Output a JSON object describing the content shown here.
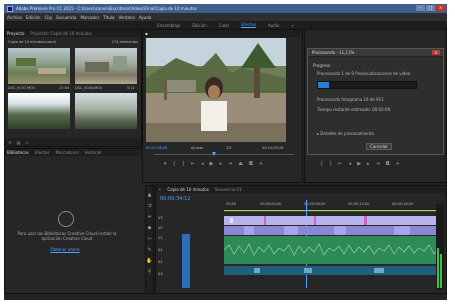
{
  "titlebar": {
    "title": "Adobe Premiere Pro CC 2015 - C:\\Users\\canvia\\Escritorio\\Videos\\Final\\Copia de 10 minutos",
    "min": "–",
    "max": "□",
    "close": "×"
  },
  "menu": [
    "Archivo",
    "Edición",
    "Clip",
    "Secuencia",
    "Marcador",
    "Título",
    "Ventana",
    "Ayuda"
  ],
  "workspaces": [
    "Ensamblaje",
    "Edición",
    "Color",
    "Efectos",
    "Audio",
    "»"
  ],
  "project": {
    "tab": "Proyecto",
    "tab2": "Proyecto: Copia de 10 minutos",
    "path": "Copia de 10 minutos.prproj",
    "count": "174 elementos",
    "clips": [
      {
        "name": "DSC_0037.MOV",
        "dur": "17:00"
      },
      {
        "name": "DSC_0040.MOV",
        "dur": "5:11"
      }
    ]
  },
  "library": {
    "tabs": [
      "Bibliotecas",
      "Efectos",
      "Marcadores",
      "Historial"
    ],
    "message": "Para usar las Bibliotecas Creative Cloud instale la aplicación Creative Cloud",
    "link": "Obtener ahora"
  },
  "program": {
    "timecode": "00;01;38;08",
    "fit": "Ajustar",
    "ratio": "1/2",
    "end": "00;10;09;26"
  },
  "source": {
    "timecode": "00;00;00;00",
    "end": "00;00;00;00"
  },
  "timeline": {
    "tabs": [
      "Copia de 10 minutos",
      "Secuencia 01"
    ],
    "timecode": "00;00;34;12",
    "ruler": [
      "00;00",
      "00;00;04;00",
      "00;00;08;00",
      "00;00;12;00",
      "00;00;16;00",
      "00;00;20;00"
    ],
    "tracks": [
      "V3",
      "V2",
      "V1",
      "A1",
      "A2",
      "A3"
    ]
  },
  "dialog": {
    "title": "Procesando - 11,11%",
    "section": "Progreso",
    "line1": "Procesando 1 de 9 Previsualizaciones de vídeo",
    "progress": 0.11,
    "line2": "Procesando fotograma 19 de 911",
    "line3": "Tiempo restante estimado: 00:03:09",
    "details": "Detalles de procesamiento",
    "cancel": "Cancelar"
  },
  "colors": {
    "accent": "#4fa3ff",
    "video_clip": "#8a87d6",
    "audio_clip": "#2e8b57"
  }
}
